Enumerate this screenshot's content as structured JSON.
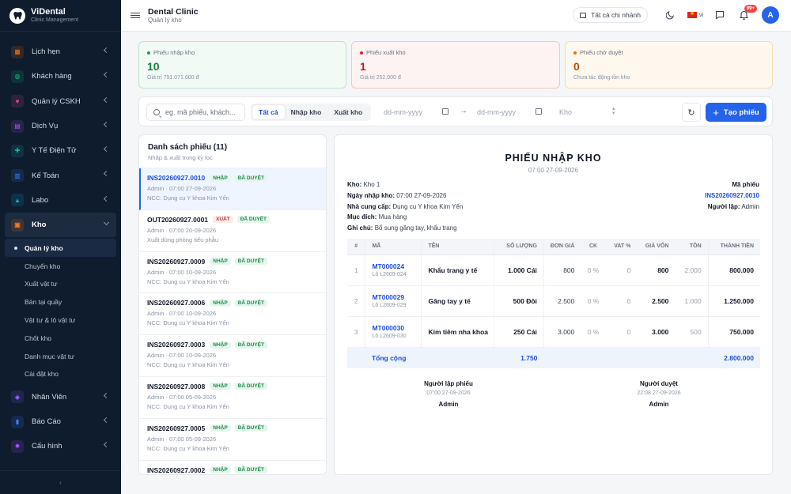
{
  "brand": {
    "name": "ViDental",
    "subtitle": "Clinic Management"
  },
  "header": {
    "title": "Dental Clinic",
    "subtitle": "Quản lý kho",
    "branch_button": "Tất cả chi nhánh",
    "lang": "vi",
    "notif_badge": "99+",
    "avatar": "A"
  },
  "nav": {
    "items": [
      {
        "label": "Lịch hẹn",
        "icon": "calendar-icon",
        "color": "#f97316"
      },
      {
        "label": "Khách hàng",
        "icon": "users-icon",
        "color": "#10b981"
      },
      {
        "label": "Quản lý CSKH",
        "icon": "heart-icon",
        "color": "#ec4899"
      },
      {
        "label": "Dịch Vụ",
        "icon": "service-icon",
        "color": "#a855f7"
      },
      {
        "label": "Y Tế Điện Tử",
        "icon": "medical-icon",
        "color": "#14b8a6"
      },
      {
        "label": "Kế Toán",
        "icon": "bank-icon",
        "color": "#3b82f6"
      },
      {
        "label": "Labo",
        "icon": "flask-icon",
        "color": "#06b6d4"
      },
      {
        "label": "Kho",
        "icon": "box-icon",
        "color": "#f97316"
      }
    ],
    "sub_items": [
      "Quản lý kho",
      "Chuyển kho",
      "Xuất vật tư",
      "Bán tại quầy",
      "Vật tư & lô vật tư",
      "Chốt kho",
      "Danh mục vật tư",
      "Cài đặt kho"
    ],
    "items_after": [
      {
        "label": "Nhân Viên",
        "icon": "staff-icon",
        "color": "#8b5cf6"
      },
      {
        "label": "Báo Cáo",
        "icon": "chart-icon",
        "color": "#3b82f6"
      },
      {
        "label": "Cấu hình",
        "icon": "settings-icon",
        "color": "#a855f7"
      }
    ],
    "collapse": "‹"
  },
  "stats": [
    {
      "label": "Phiếu nhập kho",
      "value": "10",
      "footer": "Giá trị 791.071.600 đ",
      "color": "#16a34a"
    },
    {
      "label": "Phiếu xuất kho",
      "value": "1",
      "footer": "Giá trị 252.000 đ",
      "color": "#dc2626"
    },
    {
      "label": "Phiếu chờ duyệt",
      "value": "0",
      "footer": "Chưa tác động tồn kho",
      "color": "#d97706"
    }
  ],
  "toolbar": {
    "search_placeholder": "eg. mã phiếu, khách...",
    "tabs": [
      "Tất cả",
      "Nhập kho",
      "Xuất kho"
    ],
    "date_from": "dd-mm-yyyy",
    "arrow": "→",
    "date_to": "dd-mm-yyyy",
    "warehouse_placeholder": "Kho",
    "create_label": "Tạo phiếu"
  },
  "list": {
    "title": "Danh sách phiếu (11)",
    "subtitle": "Nhập & xuất trong kỳ lọc",
    "rows": [
      {
        "code": "INS20260927.0010",
        "type": "NHẬP",
        "status": "ĐÃ DUYỆT",
        "meta": "Admin · 07:00 27-09-2026",
        "note": "NCC: Dụng cụ Y khoa Kim Yến"
      },
      {
        "code": "OUT20260927.0001",
        "type": "XUẤT",
        "status": "ĐÃ DUYỆT",
        "meta": "Admin · 07:00 20-09-2026",
        "note": "Xuất dùng phòng tiểu phẫu"
      },
      {
        "code": "INS20260927.0009",
        "type": "NHẬP",
        "status": "ĐÃ DUYỆT",
        "meta": "Admin · 07:00 10-09-2026",
        "note": "NCC: Dụng cụ Y khoa Kim Yến"
      },
      {
        "code": "INS20260927.0006",
        "type": "NHẬP",
        "status": "ĐÃ DUYỆT",
        "meta": "Admin · 07:00 10-09-2026",
        "note": "NCC: Dụng cụ Y khoa Kim Yến"
      },
      {
        "code": "INS20260927.0003",
        "type": "NHẬP",
        "status": "ĐÃ DUYỆT",
        "meta": "Admin · 07:00 10-09-2026",
        "note": "NCC: Dụng cụ Y khoa Kim Yến"
      },
      {
        "code": "INS20260927.0008",
        "type": "NHẬP",
        "status": "ĐÃ DUYỆT",
        "meta": "Admin · 07:00 05-09-2026",
        "note": "NCC: Dụng cụ Y khoa Kim Yến"
      },
      {
        "code": "INS20260927.0005",
        "type": "NHẬP",
        "status": "ĐÃ DUYỆT",
        "meta": "Admin · 07:00 05-09-2026",
        "note": "NCC: Dụng cụ Y khoa Kim Yến"
      },
      {
        "code": "INS20260927.0002",
        "type": "NHẬP",
        "status": "ĐÃ DUYỆT",
        "meta": "",
        "note": ""
      }
    ]
  },
  "detail": {
    "title": "PHIẾU NHẬP KHO",
    "time": "07:00 27-09-2026",
    "info": [
      {
        "k": "Kho:",
        "v": "Kho 1"
      },
      {
        "k": "Ngày nhập kho:",
        "v": "07:00 27-09-2026"
      },
      {
        "k": "Nhà cung cấp:",
        "v": "Dụng cụ Y khoa Kim Yến"
      },
      {
        "k": "Mục đích:",
        "v": "Mua hàng"
      },
      {
        "k": "Ghi chú:",
        "v": "Bổ sung găng tay, khẩu trang"
      }
    ],
    "code_label": "Mã phiếu",
    "code": "INS20260927.0010",
    "creator_label": "Người lập:",
    "creator": "Admin",
    "columns": [
      "#",
      "MÃ",
      "TÊN",
      "SỐ LƯỢNG",
      "ĐƠN GIÁ",
      "CK",
      "VAT %",
      "GIÁ VỐN",
      "TỒN",
      "THÀNH TIỀN"
    ],
    "rows": [
      {
        "no": "1",
        "code": "MT000024",
        "lot": "Lô L2609-024",
        "name": "Khẩu trang y tế",
        "qty": "1.000 Cái",
        "price": "800",
        "ck": "0 %",
        "vat": "0",
        "cost": "800",
        "stock": "2.000",
        "total": "800.000"
      },
      {
        "no": "2",
        "code": "MT000029",
        "lot": "Lô L2609-029",
        "name": "Găng tay y tế",
        "qty": "500 Đôi",
        "price": "2.500",
        "ck": "0 %",
        "vat": "0",
        "cost": "2.500",
        "stock": "1.000",
        "total": "1.250.000"
      },
      {
        "no": "3",
        "code": "MT000030",
        "lot": "Lô L2609-030",
        "name": "Kim tiêm nha khoa",
        "qty": "250 Cái",
        "price": "3.000",
        "ck": "0 %",
        "vat": "0",
        "cost": "3.000",
        "stock": "500",
        "total": "750.000"
      }
    ],
    "total_label": "Tổng cộng",
    "total_qty": "1.750",
    "total_amount": "2.800.000",
    "sign_left": {
      "title": "Người lập phiếu",
      "time": "07:00 27-09-2026",
      "name": "Admin"
    },
    "sign_right": {
      "title": "Người duyệt",
      "time": "22:08 27-09-2026",
      "name": "Admin"
    }
  }
}
